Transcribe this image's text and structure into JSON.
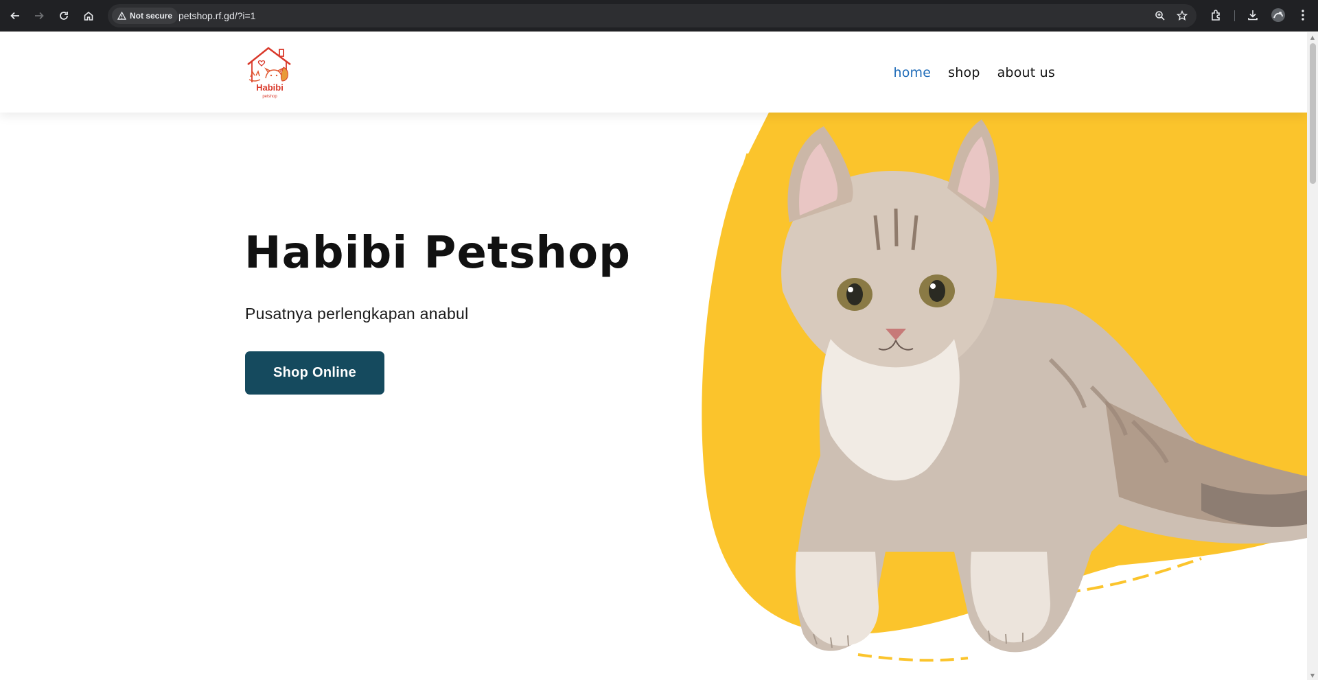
{
  "browser": {
    "security_label": "Not secure",
    "url": "petshop.rf.gd/?i=1"
  },
  "header": {
    "logo_alt": "Habibi petshop",
    "logo_text": "Habibi",
    "logo_subtext": "petshop",
    "nav": [
      {
        "label": "home",
        "active": true
      },
      {
        "label": "shop",
        "active": false
      },
      {
        "label": "about us",
        "active": false
      }
    ]
  },
  "hero": {
    "title": "Habibi Petshop",
    "subtitle": "Pusatnya perlengkapan anabul",
    "cta_label": "Shop Online",
    "image_alt": "Cat on yellow background"
  },
  "colors": {
    "accent": "#1e6bb8",
    "button": "#154a5e",
    "hero_yellow": "#fbc42c",
    "logo_red": "#d9382a"
  }
}
